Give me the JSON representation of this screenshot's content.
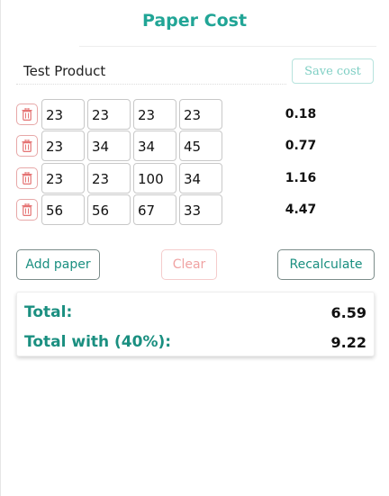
{
  "app": {
    "title": "Paper Cost"
  },
  "product": {
    "name": "Test Product",
    "save_label": "Save cost"
  },
  "rows": [
    {
      "values": [
        "23",
        "23",
        "23",
        "23"
      ],
      "cost": "0.18"
    },
    {
      "values": [
        "23",
        "34",
        "34",
        "45"
      ],
      "cost": "0.77"
    },
    {
      "values": [
        "23",
        "23",
        "100",
        "34"
      ],
      "cost": "1.16"
    },
    {
      "values": [
        "56",
        "56",
        "67",
        "33"
      ],
      "cost": "4.47"
    }
  ],
  "actions": {
    "add_label": "Add paper",
    "clear_label": "Clear",
    "recalc_label": "Recalculate"
  },
  "totals": {
    "total_label": "Total:",
    "total_value": "6.59",
    "with_label": "Total with (40%):",
    "with_value": "9.22"
  },
  "colors": {
    "accent": "#21a596",
    "danger": "#e57373"
  },
  "icons": {
    "delete": "trash-icon"
  }
}
